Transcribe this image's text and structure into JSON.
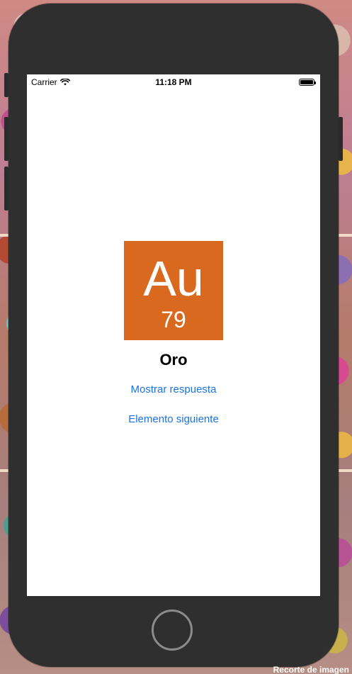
{
  "status_bar": {
    "carrier": "Carrier",
    "time": "11:18 PM",
    "wifi_icon": "wifi-icon",
    "battery_icon": "battery-icon"
  },
  "element": {
    "symbol": "Au",
    "atomic_number": "79",
    "name": "Oro",
    "tile_color": "#d9691e"
  },
  "actions": {
    "show_answer": "Mostrar respuesta",
    "next_element": "Elemento siguiente"
  },
  "overlay": {
    "caption": "Recorte de imagen"
  },
  "colors": {
    "link": "#1a73e8",
    "device_frame": "#2f2f2f"
  }
}
